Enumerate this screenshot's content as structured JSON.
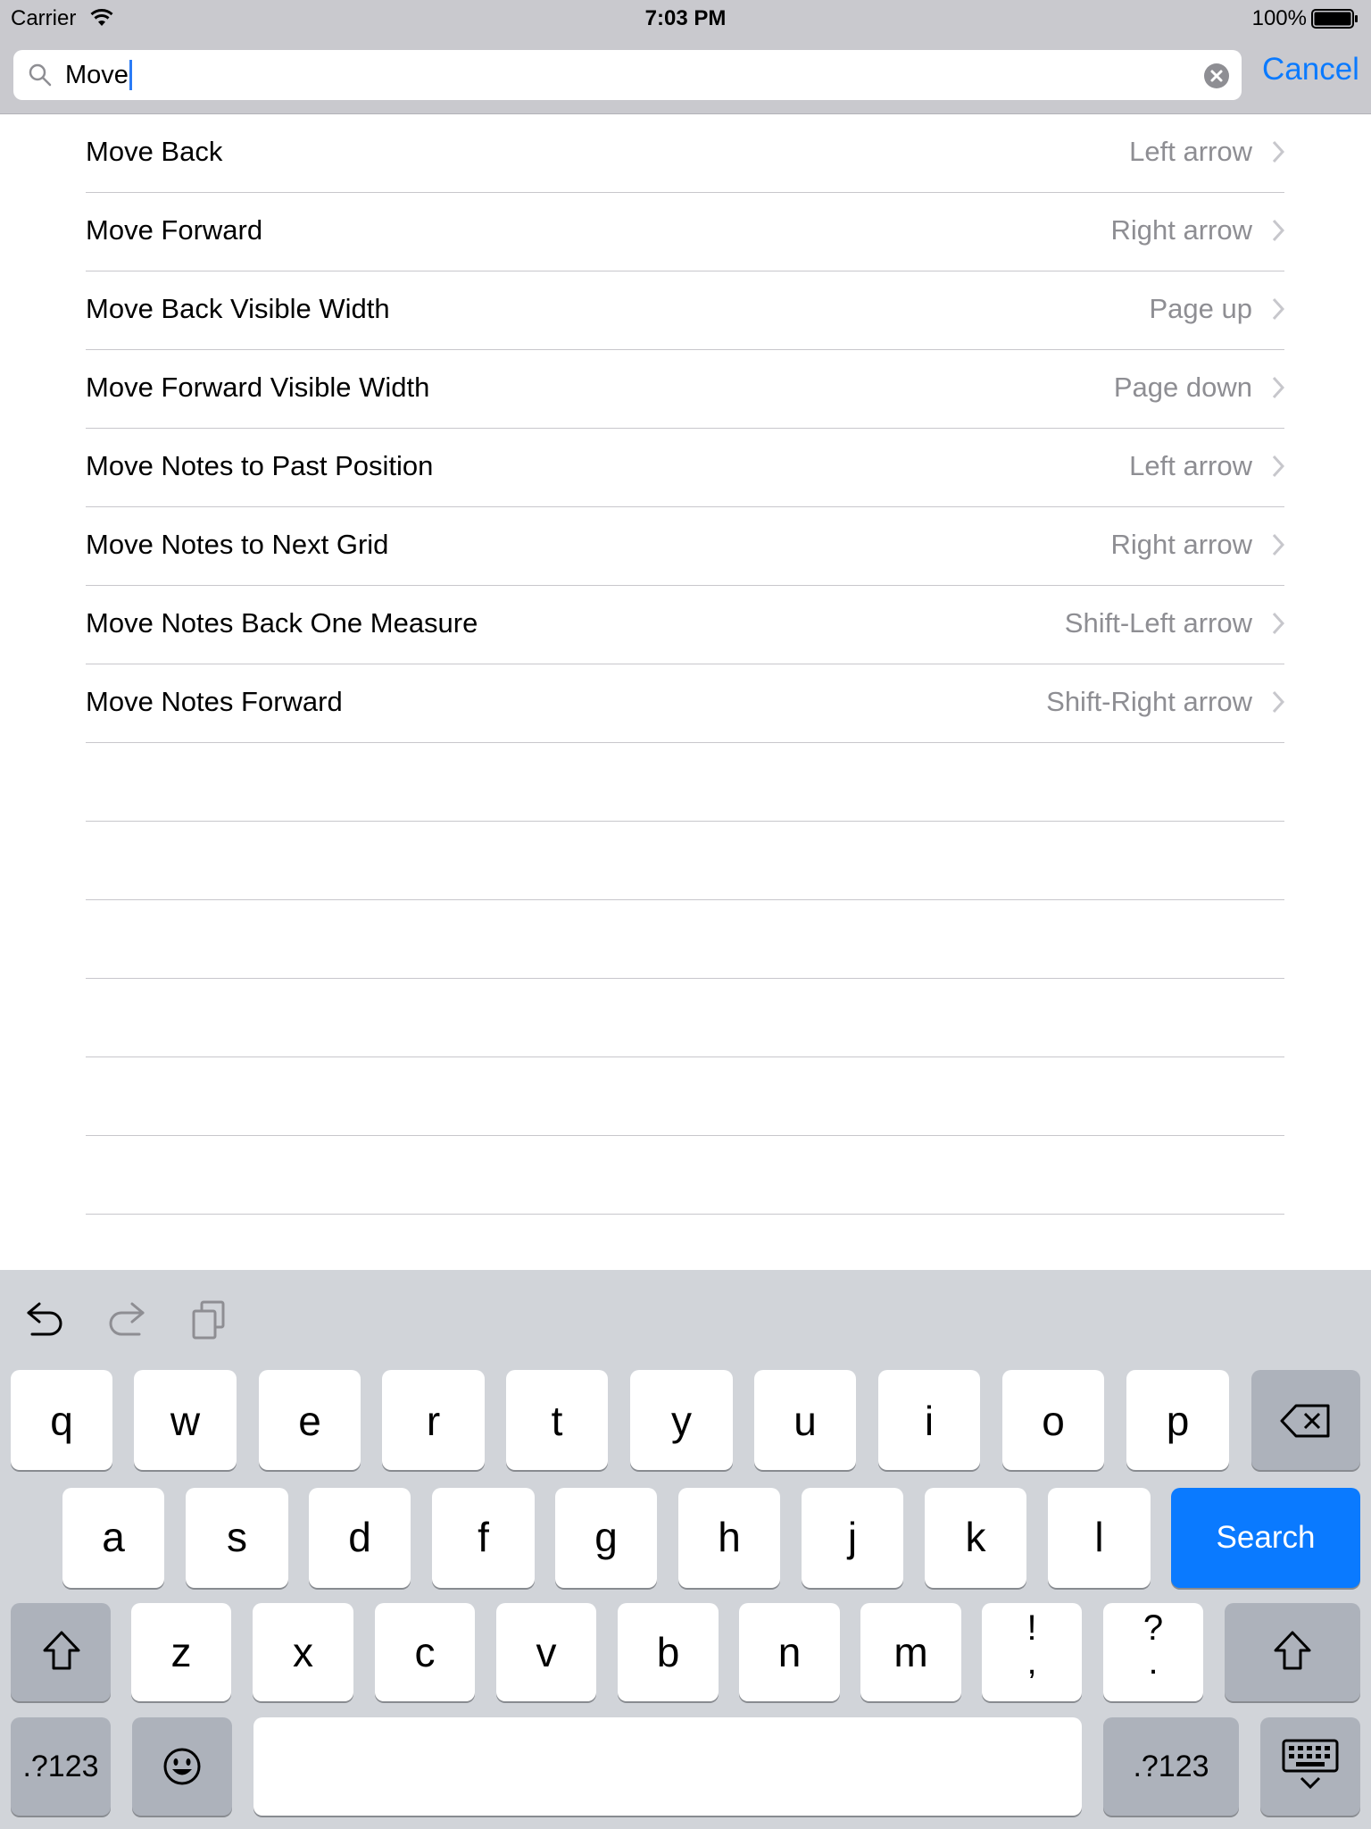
{
  "status_bar": {
    "carrier": "Carrier",
    "time": "7:03 PM",
    "battery": "100%"
  },
  "search": {
    "value": "Move",
    "cancel_label": "Cancel"
  },
  "results": [
    {
      "title": "Move Back",
      "shortcut": "Left arrow"
    },
    {
      "title": "Move Forward",
      "shortcut": "Right arrow"
    },
    {
      "title": "Move Back Visible Width",
      "shortcut": "Page up"
    },
    {
      "title": "Move Forward Visible Width",
      "shortcut": "Page down"
    },
    {
      "title": "Move Notes to Past Position",
      "shortcut": "Left arrow"
    },
    {
      "title": "Move Notes to Next Grid",
      "shortcut": "Right arrow"
    },
    {
      "title": "Move Notes Back One Measure",
      "shortcut": "Shift-Left arrow"
    },
    {
      "title": "Move Notes Forward",
      "shortcut": "Shift-Right arrow"
    }
  ],
  "keyboard": {
    "row1": [
      "q",
      "w",
      "e",
      "r",
      "t",
      "y",
      "u",
      "i",
      "o",
      "p"
    ],
    "row2": [
      "a",
      "s",
      "d",
      "f",
      "g",
      "h",
      "j",
      "k",
      "l"
    ],
    "row3": [
      "z",
      "x",
      "c",
      "v",
      "b",
      "n",
      "m"
    ],
    "punct1": {
      "top": "!",
      "bottom": ","
    },
    "punct2": {
      "top": "?",
      "bottom": "."
    },
    "search_label": "Search",
    "numbers_label": ".?123"
  },
  "colors": {
    "accent": "#0a7aff",
    "header_bg": "#c9c9ce",
    "keyboard_bg": "#d1d4d9"
  }
}
